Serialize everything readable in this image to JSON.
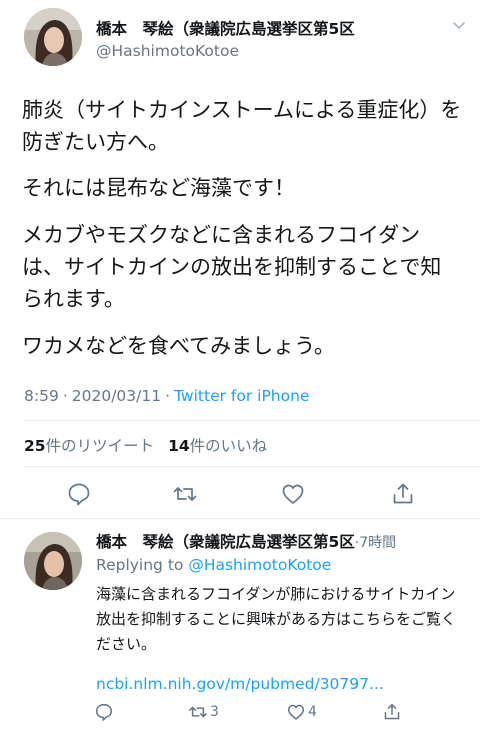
{
  "tweet": {
    "display_name": "橋本　琴絵（衆議院広島選挙区第5区",
    "handle": "@HashimotoKotoe",
    "body": [
      "肺炎（サイトカインストームによる重症化）を防ぎたい方へ。",
      "それには昆布など海藻です！",
      "メカブやモズクなどに含まれるフコイダンは、サイトカインの放出を抑制することで知られます。",
      "ワカメなどを食べてみましょう。"
    ],
    "time": "8:59",
    "separator": "·",
    "date": "2020/03/11",
    "source": "Twitter for iPhone",
    "retweet_count": "25",
    "retweet_label": "件のリツイート",
    "like_count": "14",
    "like_label": "件のいいね"
  },
  "reply": {
    "display_name": "橋本　琴絵（衆議院広島選挙区第5区",
    "separator": "·",
    "time_ago": "7時間",
    "replying_to_label": "Replying to",
    "replying_to_handle": "@HashimotoKotoe",
    "text": "海藻に含まれるフコイダンが肺におけるサイトカイン放出を抑制することに興味がある方はこちらをご覧ください。",
    "link": "ncbi.nlm.nih.gov/m/pubmed/30797...",
    "retweet_count": "3",
    "like_count": "4"
  },
  "icons": {
    "menu": "chevron-down-icon",
    "reply": "comment-icon",
    "retweet": "retweet-icon",
    "like": "heart-icon",
    "share": "share-icon"
  },
  "colors": {
    "text": "#14171a",
    "secondary": "#657786",
    "link": "#1da1f2",
    "divider": "#e6ecf0"
  }
}
